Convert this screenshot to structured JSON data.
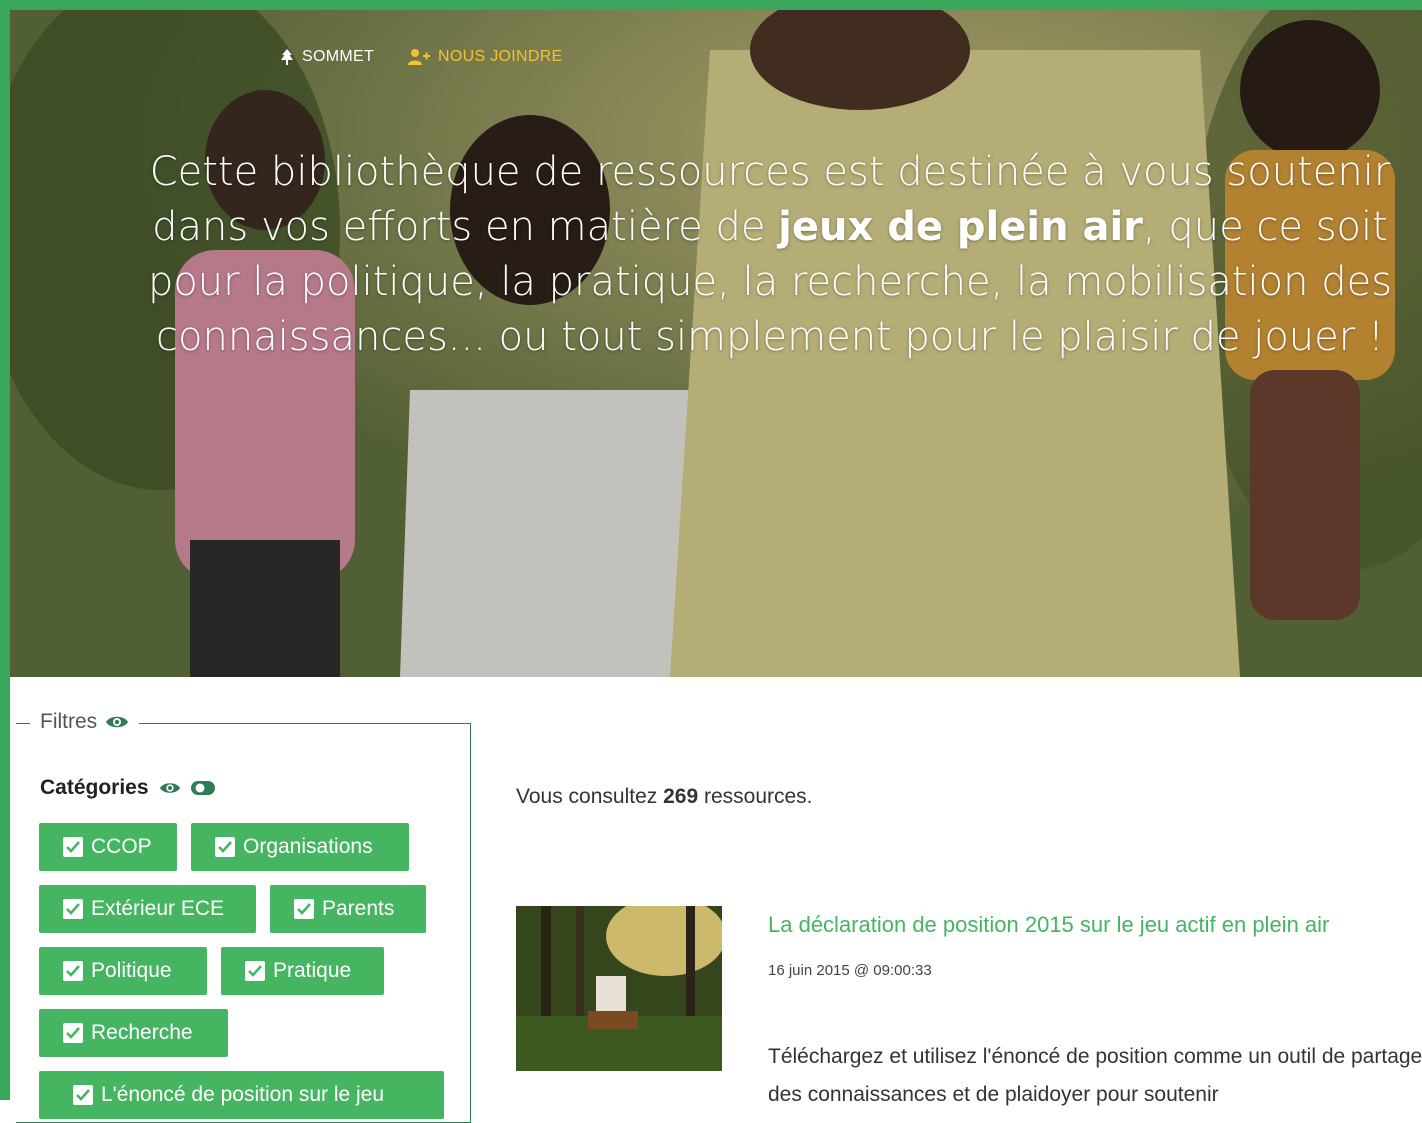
{
  "nav": {
    "items": [
      {
        "label": "SOMMET",
        "icon": "tree-icon"
      },
      {
        "label": "NOUS JOINDRE",
        "icon": "user-plus-icon"
      }
    ]
  },
  "hero": {
    "text_before": "Cette bibliothèque de ressources est destinée à vous soutenir dans vos efforts en matière de ",
    "text_bold": "jeux de plein air",
    "text_after": ", que ce soit pour la politique, la pratique, la recherche, la mobilisation des connaissances... ou tout simplement pour le plaisir de jouer !"
  },
  "filters": {
    "legend": "Filtres",
    "categories_title": "Catégories",
    "categories": [
      "CCOP",
      "Organisations",
      "Extérieur ECE",
      "Parents",
      "Politique",
      "Pratique",
      "Recherche",
      "L'énoncé de position sur le jeu"
    ]
  },
  "results": {
    "count_before": "Vous consultez ",
    "count": "269",
    "count_after": " ressources.",
    "items": [
      {
        "title": "La déclaration de position 2015 sur le jeu actif en plein air",
        "date": "16 juin 2015 @ 09:00:33",
        "description": "Téléchargez et utilisez l'énoncé de position comme un outil de partage des connaissances et de plaidoyer pour soutenir"
      }
    ]
  },
  "colors": {
    "accent": "#45b562",
    "frame": "#3aa65c",
    "nav_accent": "#f2c230",
    "fieldset_border": "#2f7b55"
  }
}
